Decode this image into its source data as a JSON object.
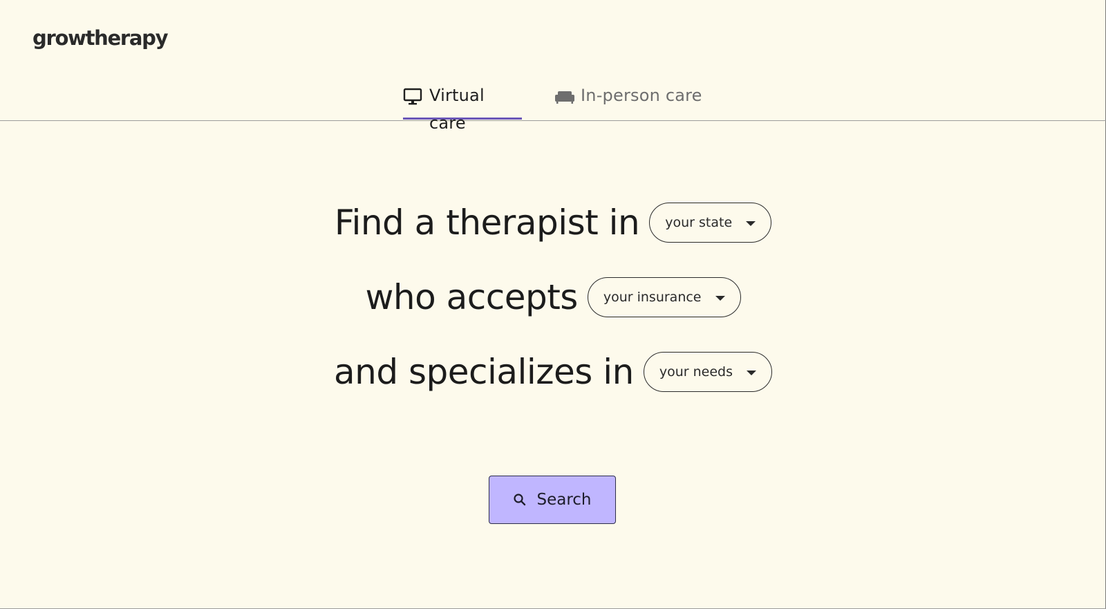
{
  "brand": {
    "logo_text": "growtherapy"
  },
  "tabs": [
    {
      "label": "Virtual care",
      "icon": "monitor-icon",
      "active": true
    },
    {
      "label": "In-person care",
      "icon": "couch-icon",
      "active": false
    }
  ],
  "headline": {
    "line1": "Find a therapist in",
    "line2": "who accepts",
    "line3": "and specializes in"
  },
  "selectors": {
    "state": "your state",
    "insurance": "your insurance",
    "needs": "your needs"
  },
  "search": {
    "label": "Search",
    "icon": "search-icon"
  },
  "colors": {
    "background": "#fdfaec",
    "active_tab_underline": "#6b57b8",
    "search_button": "#c0b6ff"
  }
}
